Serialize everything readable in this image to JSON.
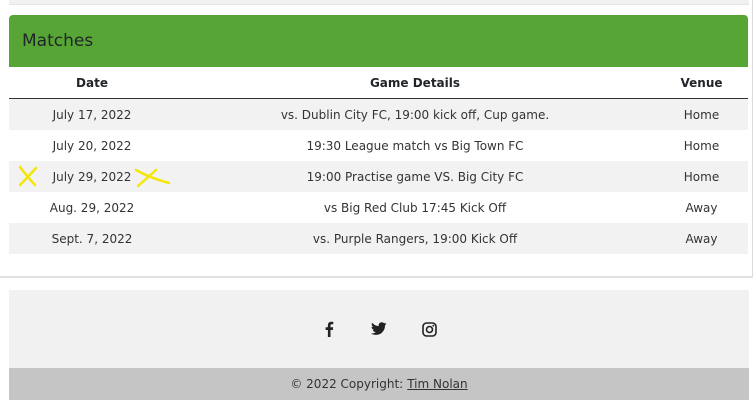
{
  "matches": {
    "title": "Matches",
    "header_color": "#57a635",
    "columns": [
      "Date",
      "Game Details",
      "Venue"
    ],
    "rows": [
      {
        "date": "July 17, 2022",
        "details": "vs. Dublin City FC, 19:00 kick off, Cup game.",
        "venue": "Home"
      },
      {
        "date": "July 20, 2022",
        "details": "19:30 League match vs Big Town FC",
        "venue": "Home"
      },
      {
        "date": "July 29, 2022",
        "details": "19:00 Practise game VS. Big City FC",
        "venue": "Home"
      },
      {
        "date": "Aug. 29, 2022",
        "details": "vs Big Red Club 17:45 Kick Off",
        "venue": "Away"
      },
      {
        "date": "Sept. 7, 2022",
        "details": "vs. Purple Rangers, 19:00 Kick Off",
        "venue": "Away"
      }
    ]
  },
  "footer": {
    "social": [
      "facebook-icon",
      "twitter-icon",
      "instagram-icon"
    ],
    "copyright": "© 2022 Copyright:",
    "author": "Tim Nolan"
  },
  "annotation_color": "#f5e60a"
}
